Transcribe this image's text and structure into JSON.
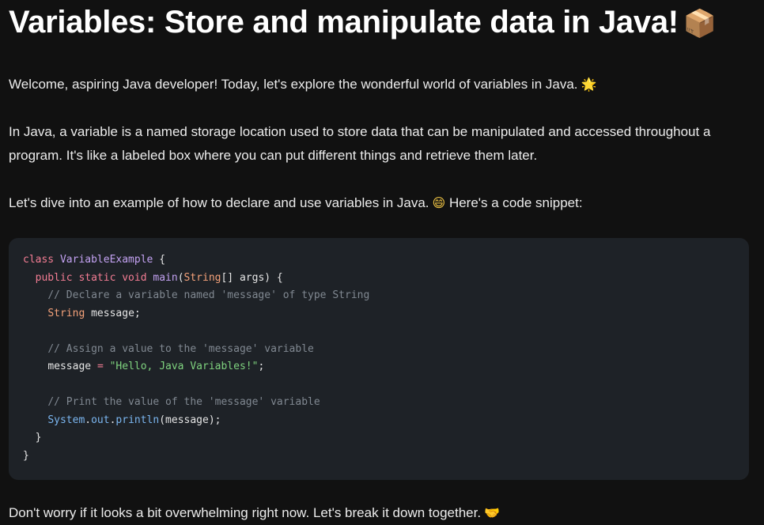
{
  "heading": {
    "title": "Variables: Store and manipulate data in Java!",
    "icon": "package-icon",
    "emoji": "📦"
  },
  "paragraphs": {
    "welcome": "Welcome, aspiring Java developer! Today, let's explore the wonderful world of variables in Java.",
    "welcome_emoji": "🌟",
    "definition": "In Java, a variable is a named storage location used to store data that can be manipulated and accessed throughout a program. It's like a labeled box where you can put different things and retrieve them later.",
    "intro_code_before": "Let's dive into an example of how to declare and use variables in Java.",
    "intro_code_emoji": "😄",
    "intro_code_after": "Here's a code snippet:",
    "closing": "Don't worry if it looks a bit overwhelming right now. Let's break it down together.",
    "closing_emoji": "🤝"
  },
  "code": {
    "language": "java",
    "line1_kw": "class",
    "line1_name": "VariableExample",
    "line1_rest": " {",
    "line2_kw": "public static void",
    "line2_fn": "main",
    "line2_type": "String",
    "line2_rest": "[] args) {",
    "line3_comment": "// Declare a variable named 'message' of type String",
    "line4_type": "String",
    "line4_rest": " message;",
    "line6_comment": "// Assign a value to the 'message' variable",
    "line7_var": "message",
    "line7_op": "=",
    "line7_str": "\"Hello, Java Variables!\"",
    "line9_comment": "// Print the value of the 'message' variable",
    "line10_obj": "System",
    "line10_field": "out",
    "line10_method": "println",
    "line10_rest": "(message);",
    "line11": "}",
    "line12": "}"
  },
  "colors": {
    "background": "#111111",
    "code_background": "#1e2227",
    "keyword": "#f47d94",
    "class_name": "#c3a2f2",
    "type": "#f5a27a",
    "comment": "#808891",
    "string": "#7fd37f",
    "object": "#7bb6f0"
  }
}
